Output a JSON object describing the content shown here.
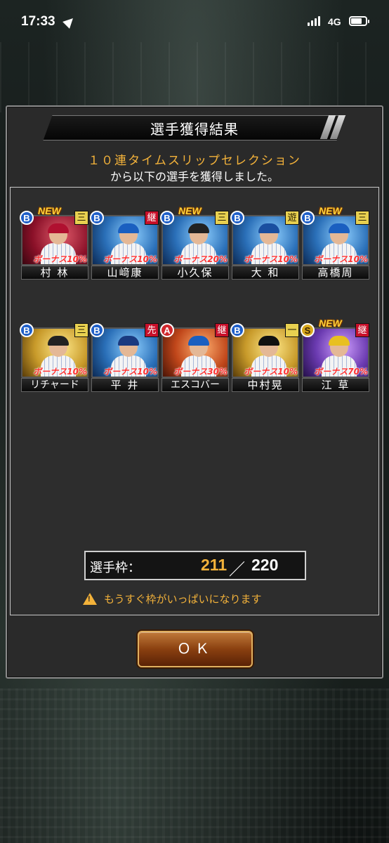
{
  "status_bar": {
    "time": "17:33",
    "network": "4G"
  },
  "dialog": {
    "title": "選手獲得結果",
    "subtitle_highlight": "１０連タイムスリップセレクション",
    "subtitle_text": "から以下の選手を獲得しました。",
    "cards": [
      {
        "name": "村 林",
        "rank": "B",
        "position": "三",
        "bonus": "ボーナス10%",
        "is_new": true,
        "new_label": "NEW"
      },
      {
        "name": "山﨑康",
        "rank": "B",
        "position": "継",
        "bonus": "ボーナス10%",
        "is_new": false,
        "new_label": ""
      },
      {
        "name": "小久保",
        "rank": "B",
        "position": "三",
        "bonus": "ボーナス20%",
        "is_new": true,
        "new_label": "NEW"
      },
      {
        "name": "大 和",
        "rank": "B",
        "position": "遊",
        "bonus": "ボーナス10%",
        "is_new": false,
        "new_label": ""
      },
      {
        "name": "高橋周",
        "rank": "B",
        "position": "三",
        "bonus": "ボーナス10%",
        "is_new": true,
        "new_label": "NEW"
      },
      {
        "name": "リチャード",
        "rank": "B",
        "position": "三",
        "bonus": "ボーナス10%",
        "is_new": false,
        "new_label": ""
      },
      {
        "name": "平 井",
        "rank": "B",
        "position": "先",
        "bonus": "ボーナス10%",
        "is_new": false,
        "new_label": ""
      },
      {
        "name": "エスコバー",
        "rank": "A",
        "position": "継",
        "bonus": "ボーナス30%",
        "is_new": false,
        "new_label": ""
      },
      {
        "name": "中村晃",
        "rank": "B",
        "position": "一",
        "bonus": "ボーナス10%",
        "is_new": false,
        "new_label": ""
      },
      {
        "name": "江 草",
        "rank": "S",
        "position": "継",
        "bonus": "ボーナス70%",
        "is_new": true,
        "new_label": "NEW"
      }
    ],
    "slots": {
      "label": "選手枠：",
      "current": "211",
      "separator": "／",
      "max": "220"
    },
    "warning": "もうすぐ枠がいっぱいになります",
    "ok_label": "ＯＫ"
  }
}
